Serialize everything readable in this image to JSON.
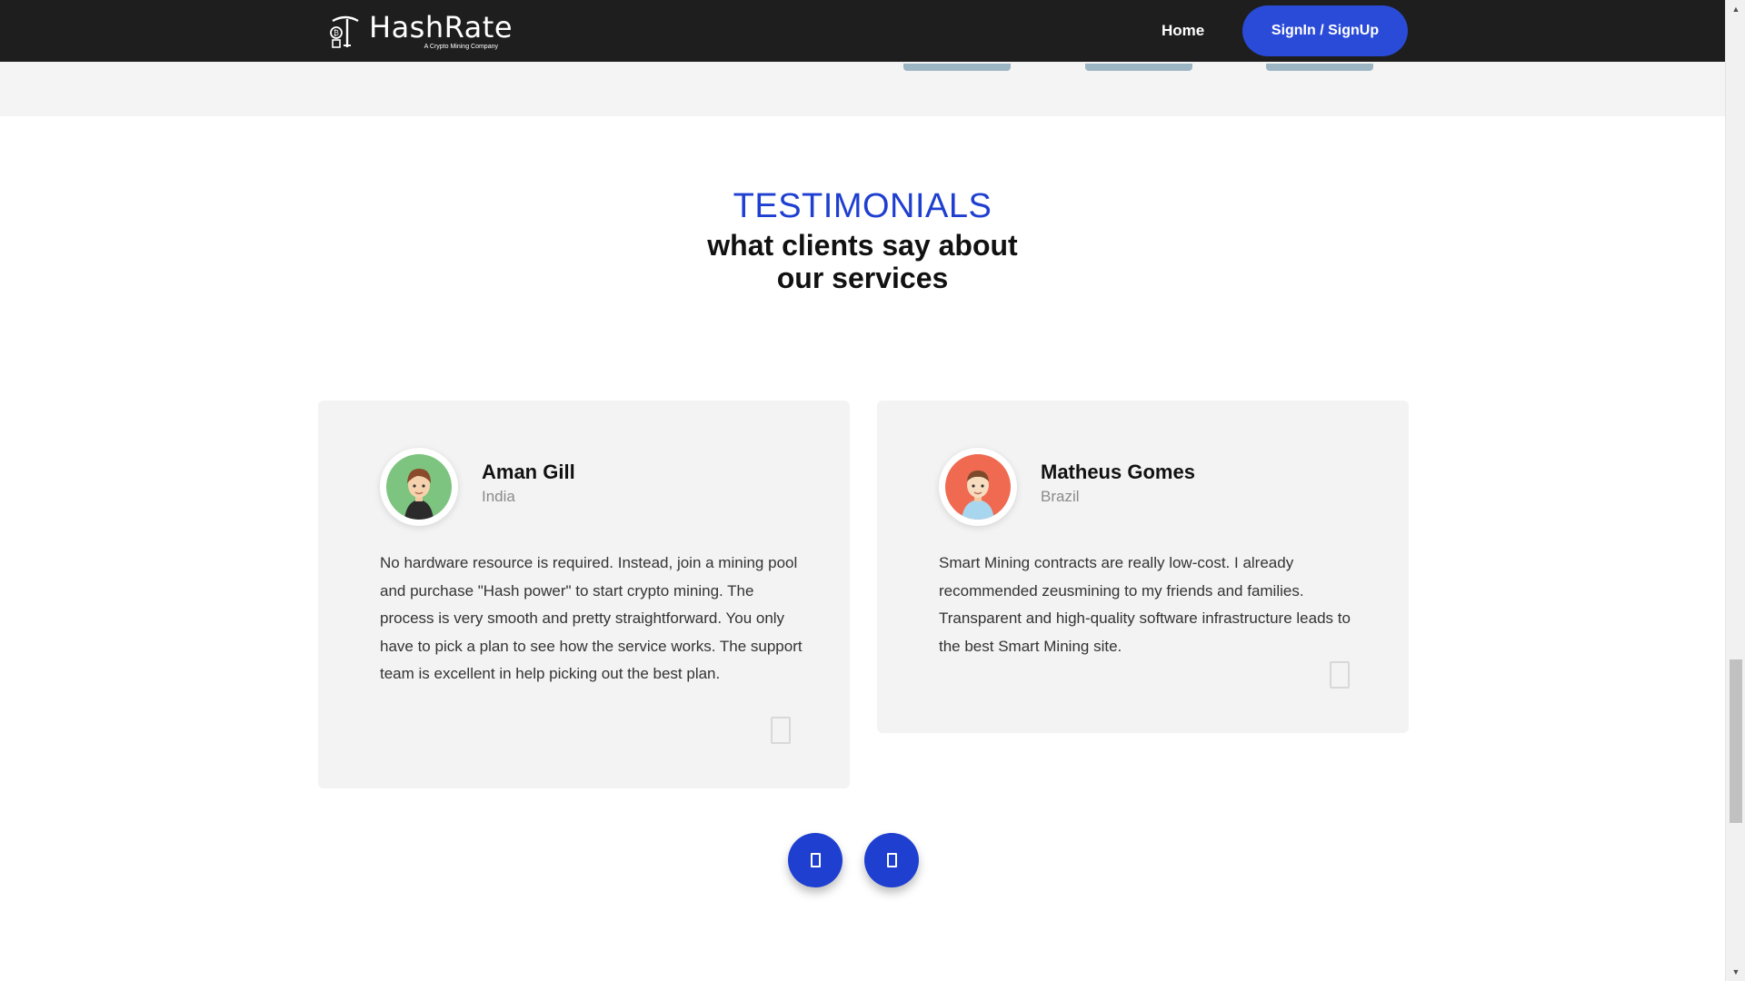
{
  "brand": {
    "name": "HashRate",
    "tagline": "A Crypto Mining Company",
    "icon": "pickaxe-bitcoin-icon"
  },
  "nav": {
    "home_label": "Home",
    "signin_label": "SignIn / SignUp",
    "accent_color": "#2a4bd7"
  },
  "testimonials": {
    "kicker": "TESTIMONIALS",
    "title_line1": "what clients say about",
    "title_line2": "our services",
    "kicker_color": "#1e3fd0",
    "cards": [
      {
        "name": "Aman Gill",
        "country": "India",
        "avatar_icon": "avatar-woman-icon",
        "avatar_color": "#7cc47f",
        "text": "No hardware resource is required. Instead, join a mining pool and purchase \"Hash power\" to start crypto mining. The process is very smooth and pretty straightforward. You only have to pick a plan to see how the service works. The support team is excellent in help picking out the best plan."
      },
      {
        "name": "Matheus Gomes",
        "country": "Brazil",
        "avatar_icon": "avatar-man-icon",
        "avatar_color": "#ef6a50",
        "text": "Smart Mining contracts are really low-cost. I already recommended zeusmining to my friends and families. Transparent and high-quality software infrastructure leads to the best Smart Mining site."
      }
    ]
  },
  "carousel": {
    "prev_icon": "prev-arrow-icon",
    "next_icon": "next-arrow-icon"
  }
}
